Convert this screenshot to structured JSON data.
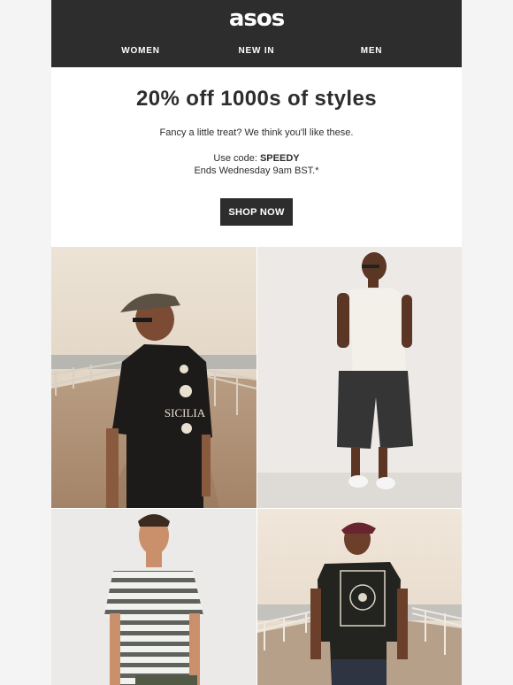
{
  "brand": {
    "logo_text": "asos"
  },
  "nav": {
    "items": [
      {
        "label": "WOMEN"
      },
      {
        "label": "NEW IN"
      },
      {
        "label": "MEN"
      }
    ]
  },
  "hero": {
    "headline": "20% off 1000s of styles",
    "subhead": "Fancy a little treat? We think you'll like these.",
    "code_prefix": "Use code: ",
    "code": "SPEEDY",
    "ends_text": "Ends Wednesday 9am BST.*",
    "cta_label": "SHOP NOW"
  },
  "products": {
    "tile1_print": "SICILIA"
  },
  "colors": {
    "header_bg": "#2d2d2d",
    "text_dark": "#2d2d2d",
    "page_bg": "#f4f4f4"
  }
}
